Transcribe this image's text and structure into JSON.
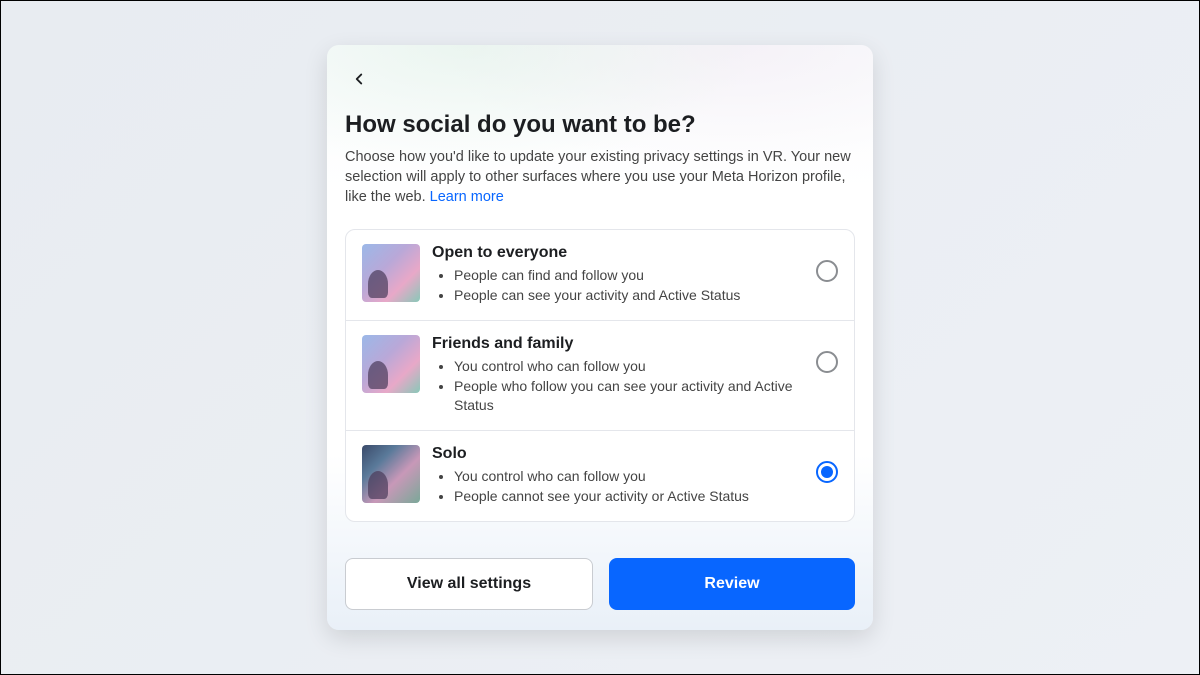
{
  "header": {
    "title": "How social do you want to be?",
    "description_pre": "Choose how you'd like to update your existing privacy settings in VR. Your new selection will apply to other surfaces where you use your Meta Horizon profile, like the web. ",
    "learn_more": "Learn more"
  },
  "options": [
    {
      "title": "Open to everyone",
      "bullets": [
        "People can find and follow you",
        "People can see your activity and Active Status"
      ],
      "selected": false
    },
    {
      "title": "Friends and family",
      "bullets": [
        "You control who can follow you",
        "People who follow you can see your activity and Active Status"
      ],
      "selected": false
    },
    {
      "title": "Solo",
      "bullets": [
        "You control who can follow you",
        "People cannot see your activity or Active Status"
      ],
      "selected": true
    }
  ],
  "footer": {
    "secondary_label": "View all settings",
    "primary_label": "Review"
  }
}
